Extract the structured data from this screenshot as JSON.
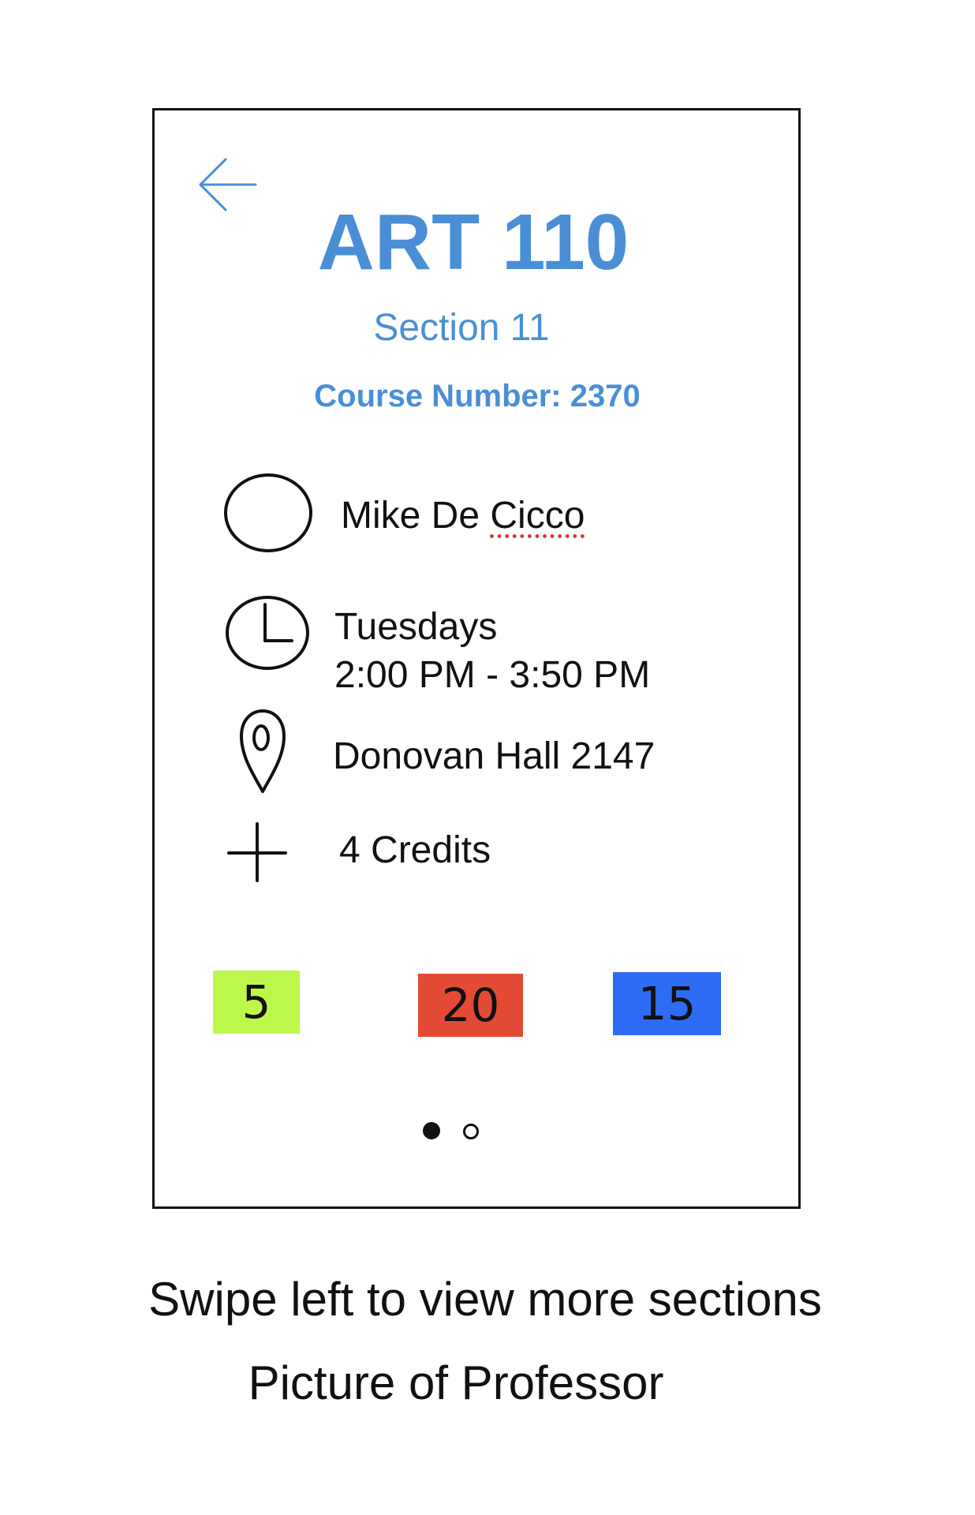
{
  "header": {
    "back_icon": "arrow-left-icon",
    "course_title": "ART 110",
    "section": "Section 11",
    "course_number": "Course Number: 2370"
  },
  "details": {
    "professor": {
      "icon": "avatar-circle-icon",
      "name_first": "Mike De ",
      "name_last": "Cicco"
    },
    "schedule": {
      "icon": "clock-icon",
      "day": "Tuesdays",
      "time": "2:00 PM - 3:50 PM"
    },
    "location": {
      "icon": "map-pin-icon",
      "text": "Donovan Hall 2147"
    },
    "credits": {
      "icon": "plus-icon",
      "text": "4 Credits"
    }
  },
  "stats": [
    {
      "value": "5",
      "color": "#bdf74a"
    },
    {
      "value": "20",
      "color": "#e24a35"
    },
    {
      "value": "15",
      "color": "#2f6cf5"
    }
  ],
  "pagination": {
    "total": 2,
    "active": 1
  },
  "annotations": {
    "swipe_note": "Swipe left to view more sections",
    "picture_note": "Picture of Professor"
  },
  "colors": {
    "accent": "#4a8fd6",
    "frame": "#111111"
  }
}
